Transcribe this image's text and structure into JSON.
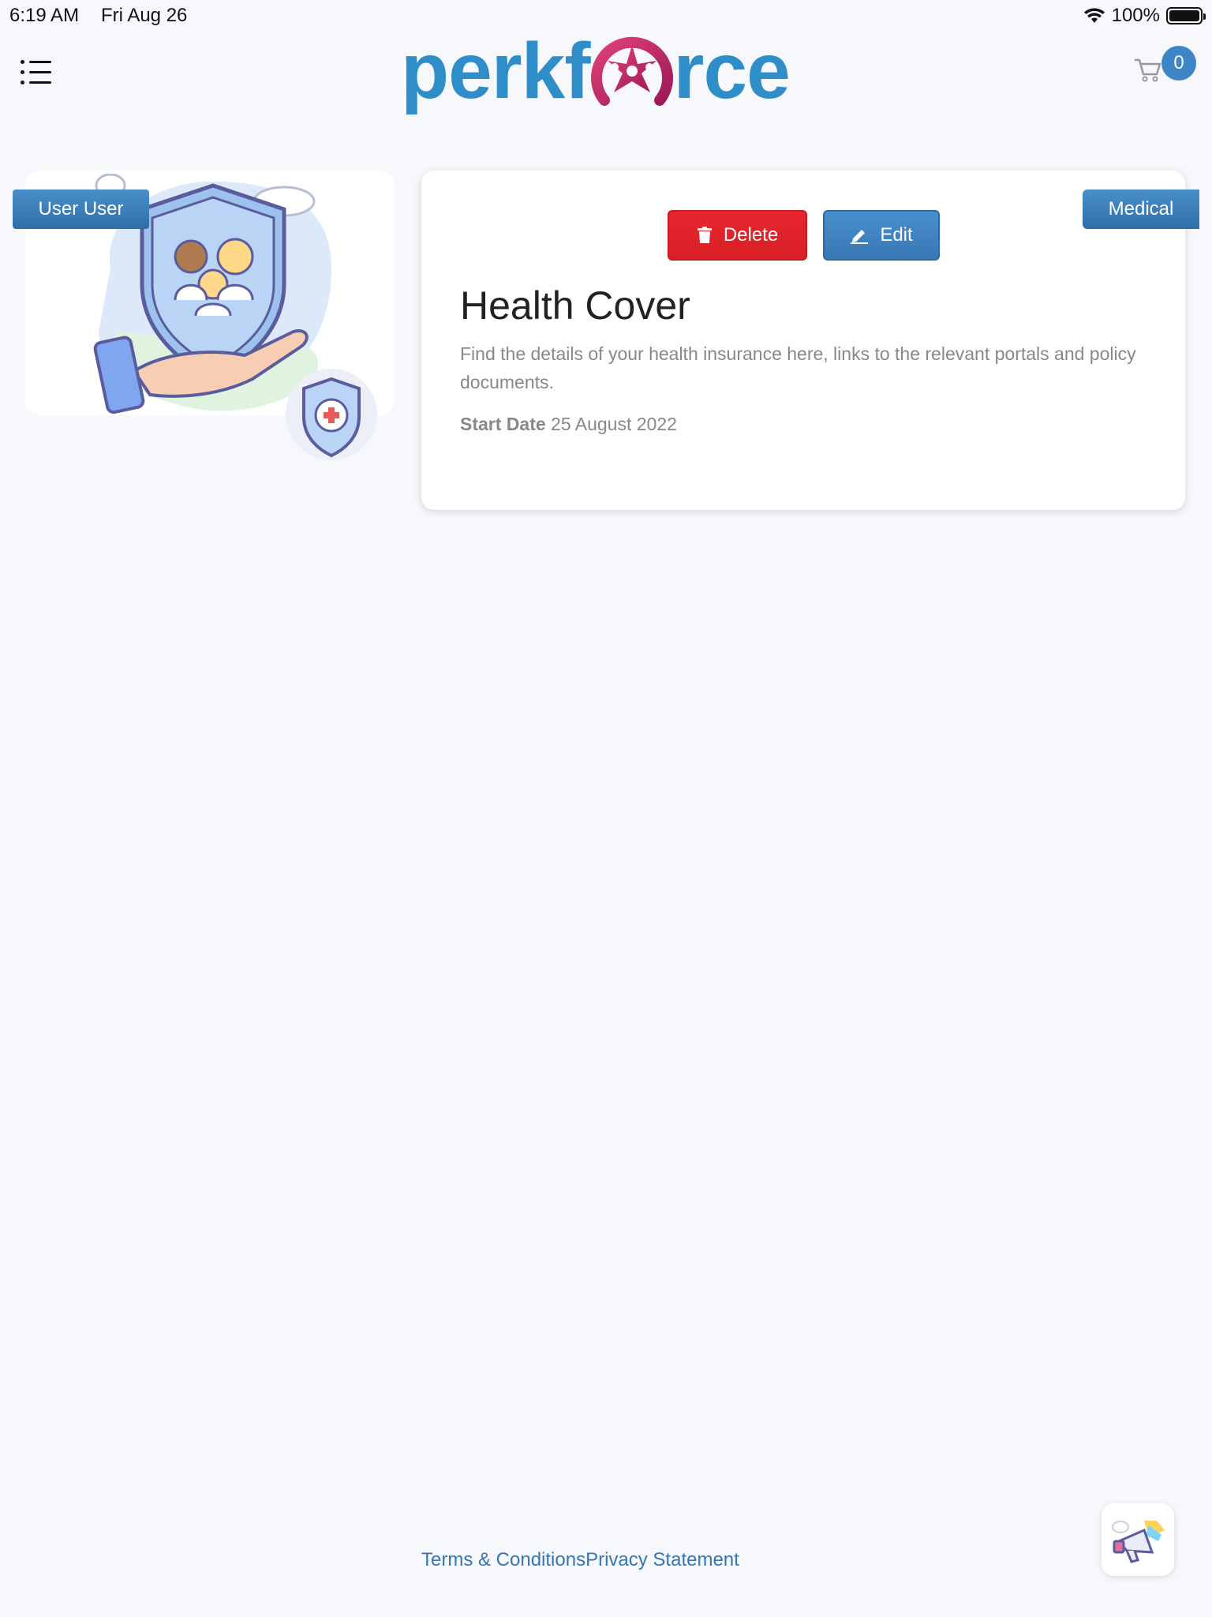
{
  "status_bar": {
    "time": "6:19 AM",
    "date": "Fri Aug 26",
    "battery": "100%"
  },
  "header": {
    "logo_text_left": "perkf",
    "logo_text_right": "rce",
    "cart_count": "0",
    "brand_color": "#2f8ec8",
    "accent_color": "#c2185b"
  },
  "tags": {
    "user": "User User",
    "category": "Medical"
  },
  "actions": {
    "delete_label": "Delete",
    "edit_label": "Edit"
  },
  "benefit": {
    "title": "Health Cover",
    "description": "Find the details of your health insurance here, links to the relevant portals and policy documents.",
    "start_date_label": "Start Date",
    "start_date_value": "25 August 2022"
  },
  "footer": {
    "terms": "Terms & Conditions",
    "privacy": "Privacy Statement"
  },
  "icons": [
    "menu-icon",
    "cart-icon",
    "trash-icon",
    "pencil-icon",
    "megaphone-icon",
    "wifi-icon",
    "battery-icon"
  ]
}
